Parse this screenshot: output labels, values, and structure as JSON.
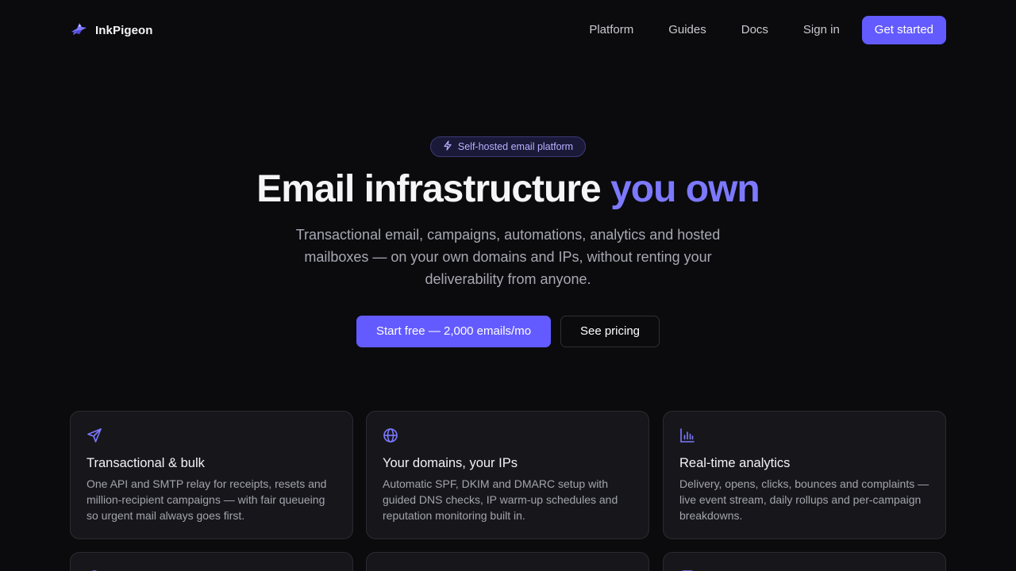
{
  "brand": {
    "name": "InkPigeon",
    "logo_icon": "pigeon-logo-icon"
  },
  "nav": {
    "items": [
      "Platform",
      "Guides",
      "Docs",
      "Sign in"
    ],
    "cta_label": "Get started"
  },
  "hero": {
    "badge_icon": "lightning-icon",
    "badge_label": "Self-hosted email platform",
    "title_main": "Email infrastructure ",
    "title_accent": "you own",
    "subtitle": "Transactional email, campaigns, automations, analytics and hosted mailboxes — on your own domains and IPs, without renting your deliverability from anyone.",
    "primary_cta": "Start free — 2,000 emails/mo",
    "secondary_cta": "See pricing"
  },
  "features": [
    {
      "icon": "send-icon",
      "title": "Transactional & bulk",
      "text": "One API and SMTP relay for receipts, resets and million-recipient campaigns — with fair queueing so urgent mail always goes first."
    },
    {
      "icon": "globe-icon",
      "title": "Your domains, your IPs",
      "text": "Automatic SPF, DKIM and DMARC setup with guided DNS checks, IP warm-up schedules and reputation monitoring built in."
    },
    {
      "icon": "bar-chart-icon",
      "title": "Real-time analytics",
      "text": "Delivery, opens, clicks, bounces and complaints — live event stream, daily rollups and per-campaign breakdowns."
    }
  ],
  "colors": {
    "background": "#0b0b0e",
    "accent": "#635bff",
    "accent_text": "#7d79ff",
    "card": "#17171b"
  }
}
